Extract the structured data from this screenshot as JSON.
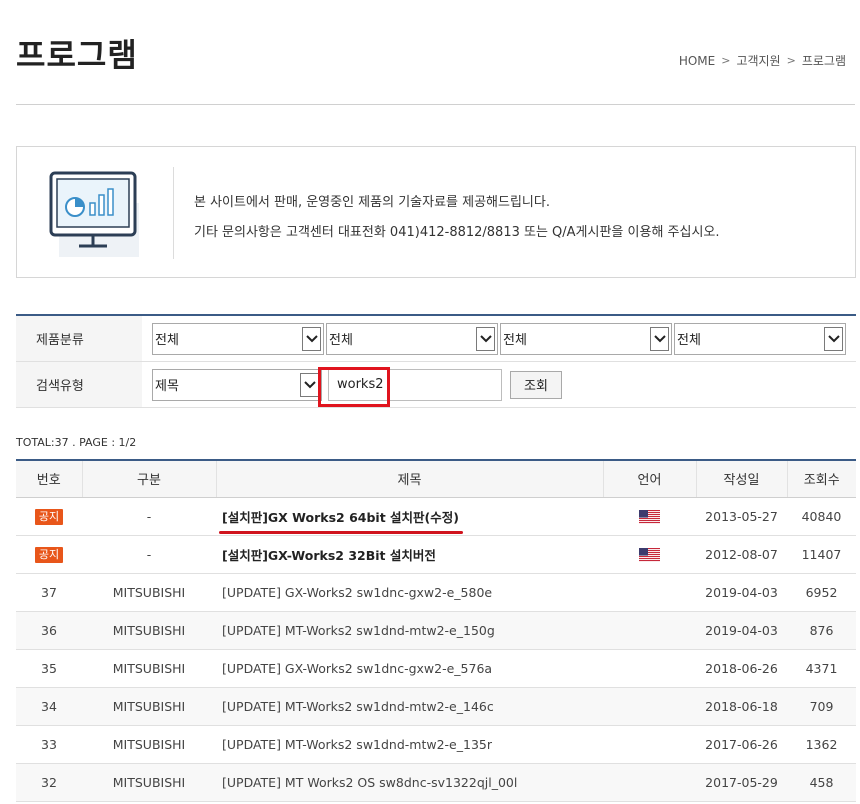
{
  "page": {
    "title": "프로그램",
    "breadcrumb": [
      "HOME",
      "고객지원",
      "프로그램"
    ],
    "breadcrumb_sep": ">"
  },
  "info": {
    "line1": "본 사이트에서 판매, 운영중인 제품의 기술자료를 제공해드립니다.",
    "line2": "기타 문의사항은 고객센터 대표전화 041)412-8812/8813 또는 Q/A게시판을 이용해 주십시오."
  },
  "filter": {
    "category_label": "제품분류",
    "category_selects": [
      "전체",
      "전체",
      "전체",
      "전체"
    ],
    "search_type_label": "검색유형",
    "search_type_value": "제목",
    "search_value": "works2",
    "search_button": "조회"
  },
  "total_text": "TOTAL:37 . PAGE : 1/2",
  "table": {
    "headers": [
      "번호",
      "구분",
      "제목",
      "언어",
      "작성일",
      "조회수"
    ],
    "notice_label": "공지",
    "rows": [
      {
        "no": "공지",
        "category": "-",
        "title": "[설치판]GX Works2 64bit 설치판(수정)",
        "lang": "us-flag",
        "date": "2013-05-27",
        "views": "40840"
      },
      {
        "no": "공지",
        "category": "-",
        "title": "[설치판]GX-Works2 32Bit 설치버전",
        "lang": "us-flag",
        "date": "2012-08-07",
        "views": "11407"
      },
      {
        "no": "37",
        "category": "MITSUBISHI",
        "title": "[UPDATE] GX-Works2 sw1dnc-gxw2-e_580e",
        "lang": "",
        "date": "2019-04-03",
        "views": "6952"
      },
      {
        "no": "36",
        "category": "MITSUBISHI",
        "title": "[UPDATE] MT-Works2 sw1dnd-mtw2-e_150g",
        "lang": "",
        "date": "2019-04-03",
        "views": "876"
      },
      {
        "no": "35",
        "category": "MITSUBISHI",
        "title": "[UPDATE] GX-Works2 sw1dnc-gxw2-e_576a",
        "lang": "",
        "date": "2018-06-26",
        "views": "4371"
      },
      {
        "no": "34",
        "category": "MITSUBISHI",
        "title": "[UPDATE] MT-Works2 sw1dnd-mtw2-e_146c",
        "lang": "",
        "date": "2018-06-18",
        "views": "709"
      },
      {
        "no": "33",
        "category": "MITSUBISHI",
        "title": "[UPDATE] MT-Works2 sw1dnd-mtw2-e_135r",
        "lang": "",
        "date": "2017-06-26",
        "views": "1362"
      },
      {
        "no": "32",
        "category": "MITSUBISHI",
        "title": "[UPDATE] MT Works2 OS sw8dnc-sv1322qjl_00l",
        "lang": "",
        "date": "2017-05-29",
        "views": "458"
      }
    ]
  },
  "colors": {
    "accent": "#3b5b86",
    "notice_badge": "#e8561a",
    "highlight": "#e0141e"
  }
}
